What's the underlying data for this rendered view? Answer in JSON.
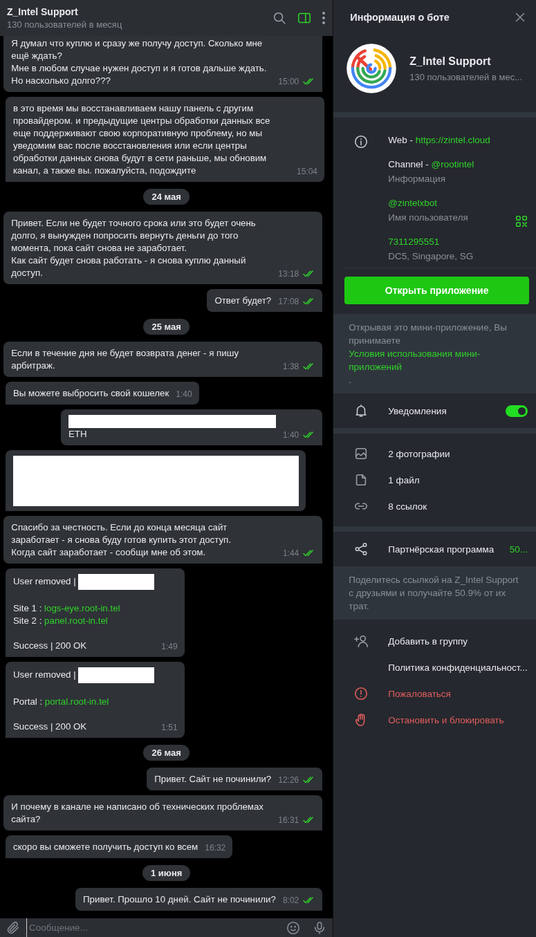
{
  "chat": {
    "title": "Z_Intel Support",
    "subtitle": "130 пользователей в месяц",
    "panel_toggle_on": true,
    "items": [
      {
        "kind": "message",
        "outgoing": true,
        "read": true,
        "time": "15:00",
        "lines": [
          {
            "kind": "text",
            "text": "Я думал что куплю и сразу же получу доступ. Сколько мне ещё ждать?\nМне в любом случае нужен доступ и я готов дальше ждать. Но насколько долго???"
          }
        ]
      },
      {
        "kind": "message",
        "outgoing": false,
        "time": "15:04",
        "lines": [
          {
            "kind": "text",
            "text": "в это время мы восстанавливаем нашу панель с другим провайдером. и предыдущие центры обработки данных все еще поддерживают свою корпоративную проблему, но мы уведомим вас после восстановления или если центры обработки данных снова будут в сети раньше, мы обновим канал, а также вы. пожалуйста, подождите"
          }
        ]
      },
      {
        "kind": "date",
        "text": "24 мая"
      },
      {
        "kind": "message",
        "outgoing": true,
        "read": true,
        "time": "13:18",
        "lines": [
          {
            "kind": "text",
            "text": "Привет. Если не будет точного срока или это будет очень долго, я вынужден попросить вернуть деньги до того момента, пока сайт снова не заработает.\nКак сайт будет снова работать - я снова куплю данный доступ."
          }
        ]
      },
      {
        "kind": "message",
        "outgoing": true,
        "read": true,
        "time": "17:08",
        "lines": [
          {
            "kind": "text",
            "text": "Ответ будет?"
          }
        ]
      },
      {
        "kind": "date",
        "text": "25 мая"
      },
      {
        "kind": "message",
        "outgoing": true,
        "read": true,
        "time": "1:38",
        "lines": [
          {
            "kind": "text",
            "text": "Если в течение дня не будет возврата денег - я пишу арбитраж."
          }
        ]
      },
      {
        "kind": "message",
        "outgoing": false,
        "time": "1:40",
        "lines": [
          {
            "kind": "text",
            "text": "Вы можете выбросить свой кошелек"
          }
        ]
      },
      {
        "kind": "message",
        "outgoing": true,
        "read": true,
        "time": "1:40",
        "lines": [
          {
            "kind": "redacted-line"
          },
          {
            "kind": "text",
            "text": "ETH"
          }
        ]
      },
      {
        "kind": "message",
        "outgoing": false,
        "lines": [
          {
            "kind": "redacted-block"
          }
        ]
      },
      {
        "kind": "message",
        "outgoing": true,
        "read": true,
        "time": "1:44",
        "lines": [
          {
            "kind": "text",
            "text": "Спасибо за честность. Если до конца месяца сайт заработает - я снова буду готов купить этот доступ.\nКогда сайт заработает - сообщи мне об этом."
          }
        ]
      },
      {
        "kind": "message",
        "outgoing": false,
        "time": "1:49",
        "lines": [
          {
            "kind": "labeled-redaction",
            "label": "User removed |"
          },
          {
            "kind": "spacer"
          },
          {
            "kind": "field",
            "label": "Site 1 :",
            "link": "logs-eye.root-in.tel"
          },
          {
            "kind": "field",
            "label": "Site 2 :",
            "link": "panel.root-in.tel"
          },
          {
            "kind": "spacer"
          },
          {
            "kind": "text",
            "text": "Success | 200 OK"
          }
        ]
      },
      {
        "kind": "message",
        "outgoing": false,
        "time": "1:51",
        "lines": [
          {
            "kind": "labeled-redaction",
            "label": "User removed |"
          },
          {
            "kind": "spacer"
          },
          {
            "kind": "field",
            "label": "Portal :",
            "link": "portal.root-in.tel"
          },
          {
            "kind": "spacer"
          },
          {
            "kind": "text",
            "text": "Success | 200 OK"
          }
        ]
      },
      {
        "kind": "date",
        "text": "26 мая"
      },
      {
        "kind": "message",
        "outgoing": true,
        "read": true,
        "time": "12:26",
        "lines": [
          {
            "kind": "text",
            "text": "Привет. Сайт не починили?"
          }
        ]
      },
      {
        "kind": "message",
        "outgoing": true,
        "read": true,
        "time": "16:31",
        "lines": [
          {
            "kind": "text",
            "text": "И почему в канале не написано об технических проблемах сайта?"
          }
        ]
      },
      {
        "kind": "message",
        "outgoing": false,
        "time": "16:32",
        "lines": [
          {
            "kind": "text",
            "text": "скоро вы сможете получить доступ ко всем"
          }
        ]
      },
      {
        "kind": "date",
        "text": "1 июня"
      },
      {
        "kind": "message",
        "outgoing": true,
        "read": true,
        "time": "8:02",
        "lines": [
          {
            "kind": "text",
            "text": "Привет. Прошло 10 дней. Сайт не починили?"
          }
        ]
      }
    ],
    "composer": {
      "placeholder": "Сообщение..."
    }
  },
  "panel": {
    "title": "Информация о боте",
    "name": "Z_Intel Support",
    "subtitle": "130 пользователей в мес...",
    "info": [
      {
        "kind": "labeled-link",
        "label": "Web - ",
        "link": "https://zintel.cloud"
      },
      {
        "kind": "labeled-link",
        "label": "Channel - ",
        "link": "@rootintel",
        "caption": "Информация"
      },
      {
        "kind": "username",
        "value": "@zintelxbot",
        "caption": "Имя пользователя"
      },
      {
        "kind": "id",
        "value": "7311295551",
        "caption": "DC5, Singapore, SG"
      }
    ],
    "open_button": "Открыть приложение",
    "terms": {
      "before": "Открывая это мини-приложение, Вы принимаете ",
      "link": "Условия использования мини-приложений",
      "after": "."
    },
    "notifications": {
      "label": "Уведомления",
      "on": true
    },
    "media": [
      {
        "kind": "photos",
        "label": "2 фотографии"
      },
      {
        "kind": "files",
        "label": "1 файл"
      },
      {
        "kind": "links",
        "label": "8 ссылок"
      }
    ],
    "affiliate": {
      "label": "Партнёрская программа",
      "value": "50...",
      "note": "Поделитесь ссылкой на Z_Intel Support с друзьями и получайте 50.9% от их трат."
    },
    "actions": [
      {
        "kind": "add",
        "label": "Добавить в группу",
        "danger": false
      },
      {
        "kind": "privacy",
        "label": "Политика конфиденциальност...",
        "danger": false
      },
      {
        "kind": "report",
        "label": "Пожаловаться",
        "danger": true
      },
      {
        "kind": "block",
        "label": "Остановить и блокировать",
        "danger": true
      }
    ]
  }
}
